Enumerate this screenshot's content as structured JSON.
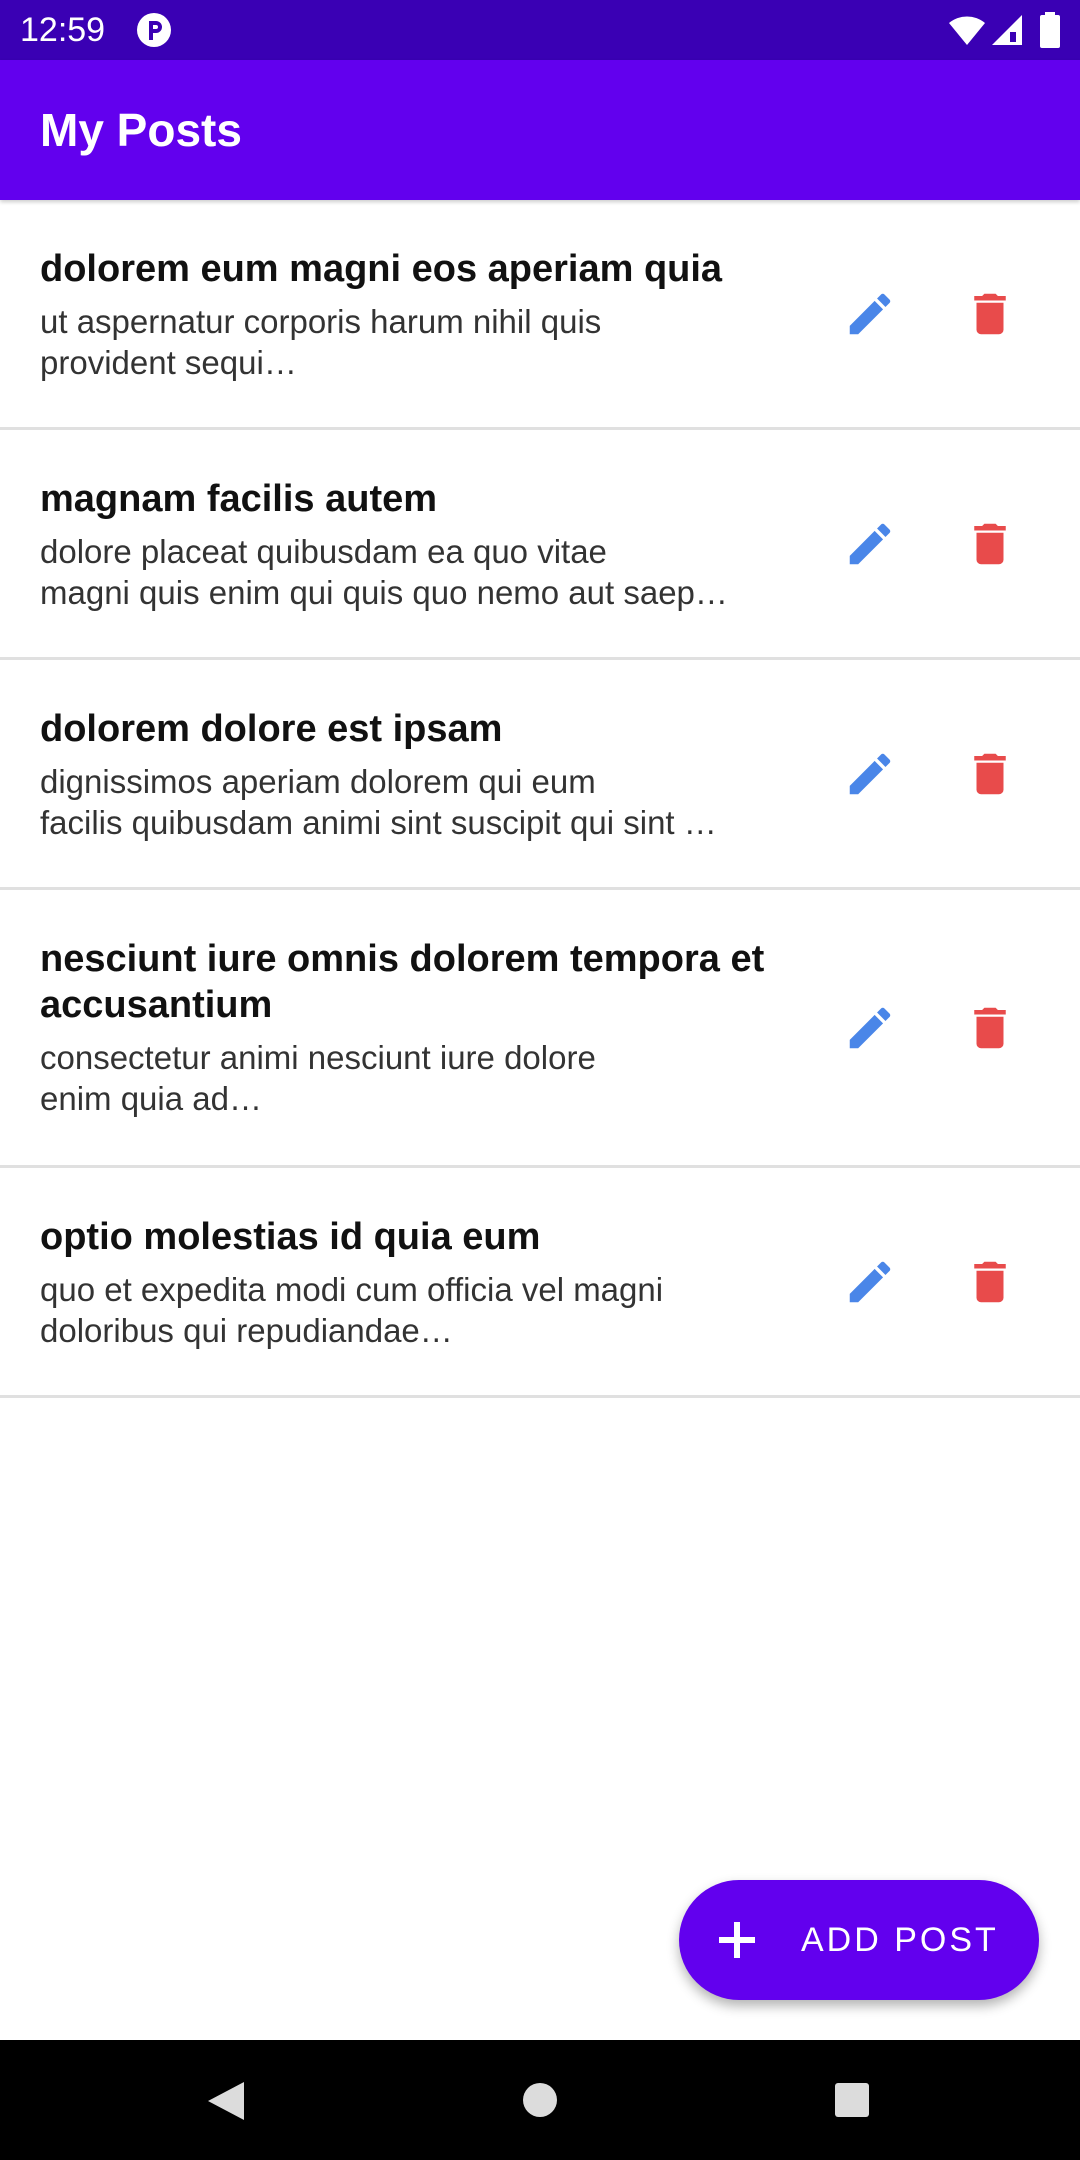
{
  "status_bar": {
    "time": "12:59"
  },
  "app_bar": {
    "title": "My Posts"
  },
  "posts": [
    {
      "title": "dolorem eum magni eos aperiam quia",
      "body": "ut aspernatur corporis harum nihil quis\nprovident sequi…"
    },
    {
      "title": "magnam facilis autem",
      "body": "dolore placeat quibusdam ea quo vitae\nmagni quis enim qui quis quo nemo aut saep…"
    },
    {
      "title": "dolorem dolore est ipsam",
      "body": "dignissimos aperiam dolorem qui eum\nfacilis quibusdam animi sint suscipit qui sint …"
    },
    {
      "title": "nesciunt iure omnis dolorem tempora et accusantium",
      "body": "consectetur animi nesciunt iure dolore\nenim quia ad…"
    },
    {
      "title": "optio molestias id quia eum",
      "body": "quo et expedita modi cum officia vel magni\ndoloribus qui repudiandae…"
    }
  ],
  "icons": {
    "edit": "pencil-icon",
    "delete": "trash-icon",
    "add": "plus-icon"
  },
  "colors": {
    "status_bar": "#3a00b4",
    "primary": "#6200ee",
    "edit_icon": "#4a86e8",
    "delete_icon": "#e84b4b"
  },
  "fab": {
    "label": "ADD POST"
  }
}
